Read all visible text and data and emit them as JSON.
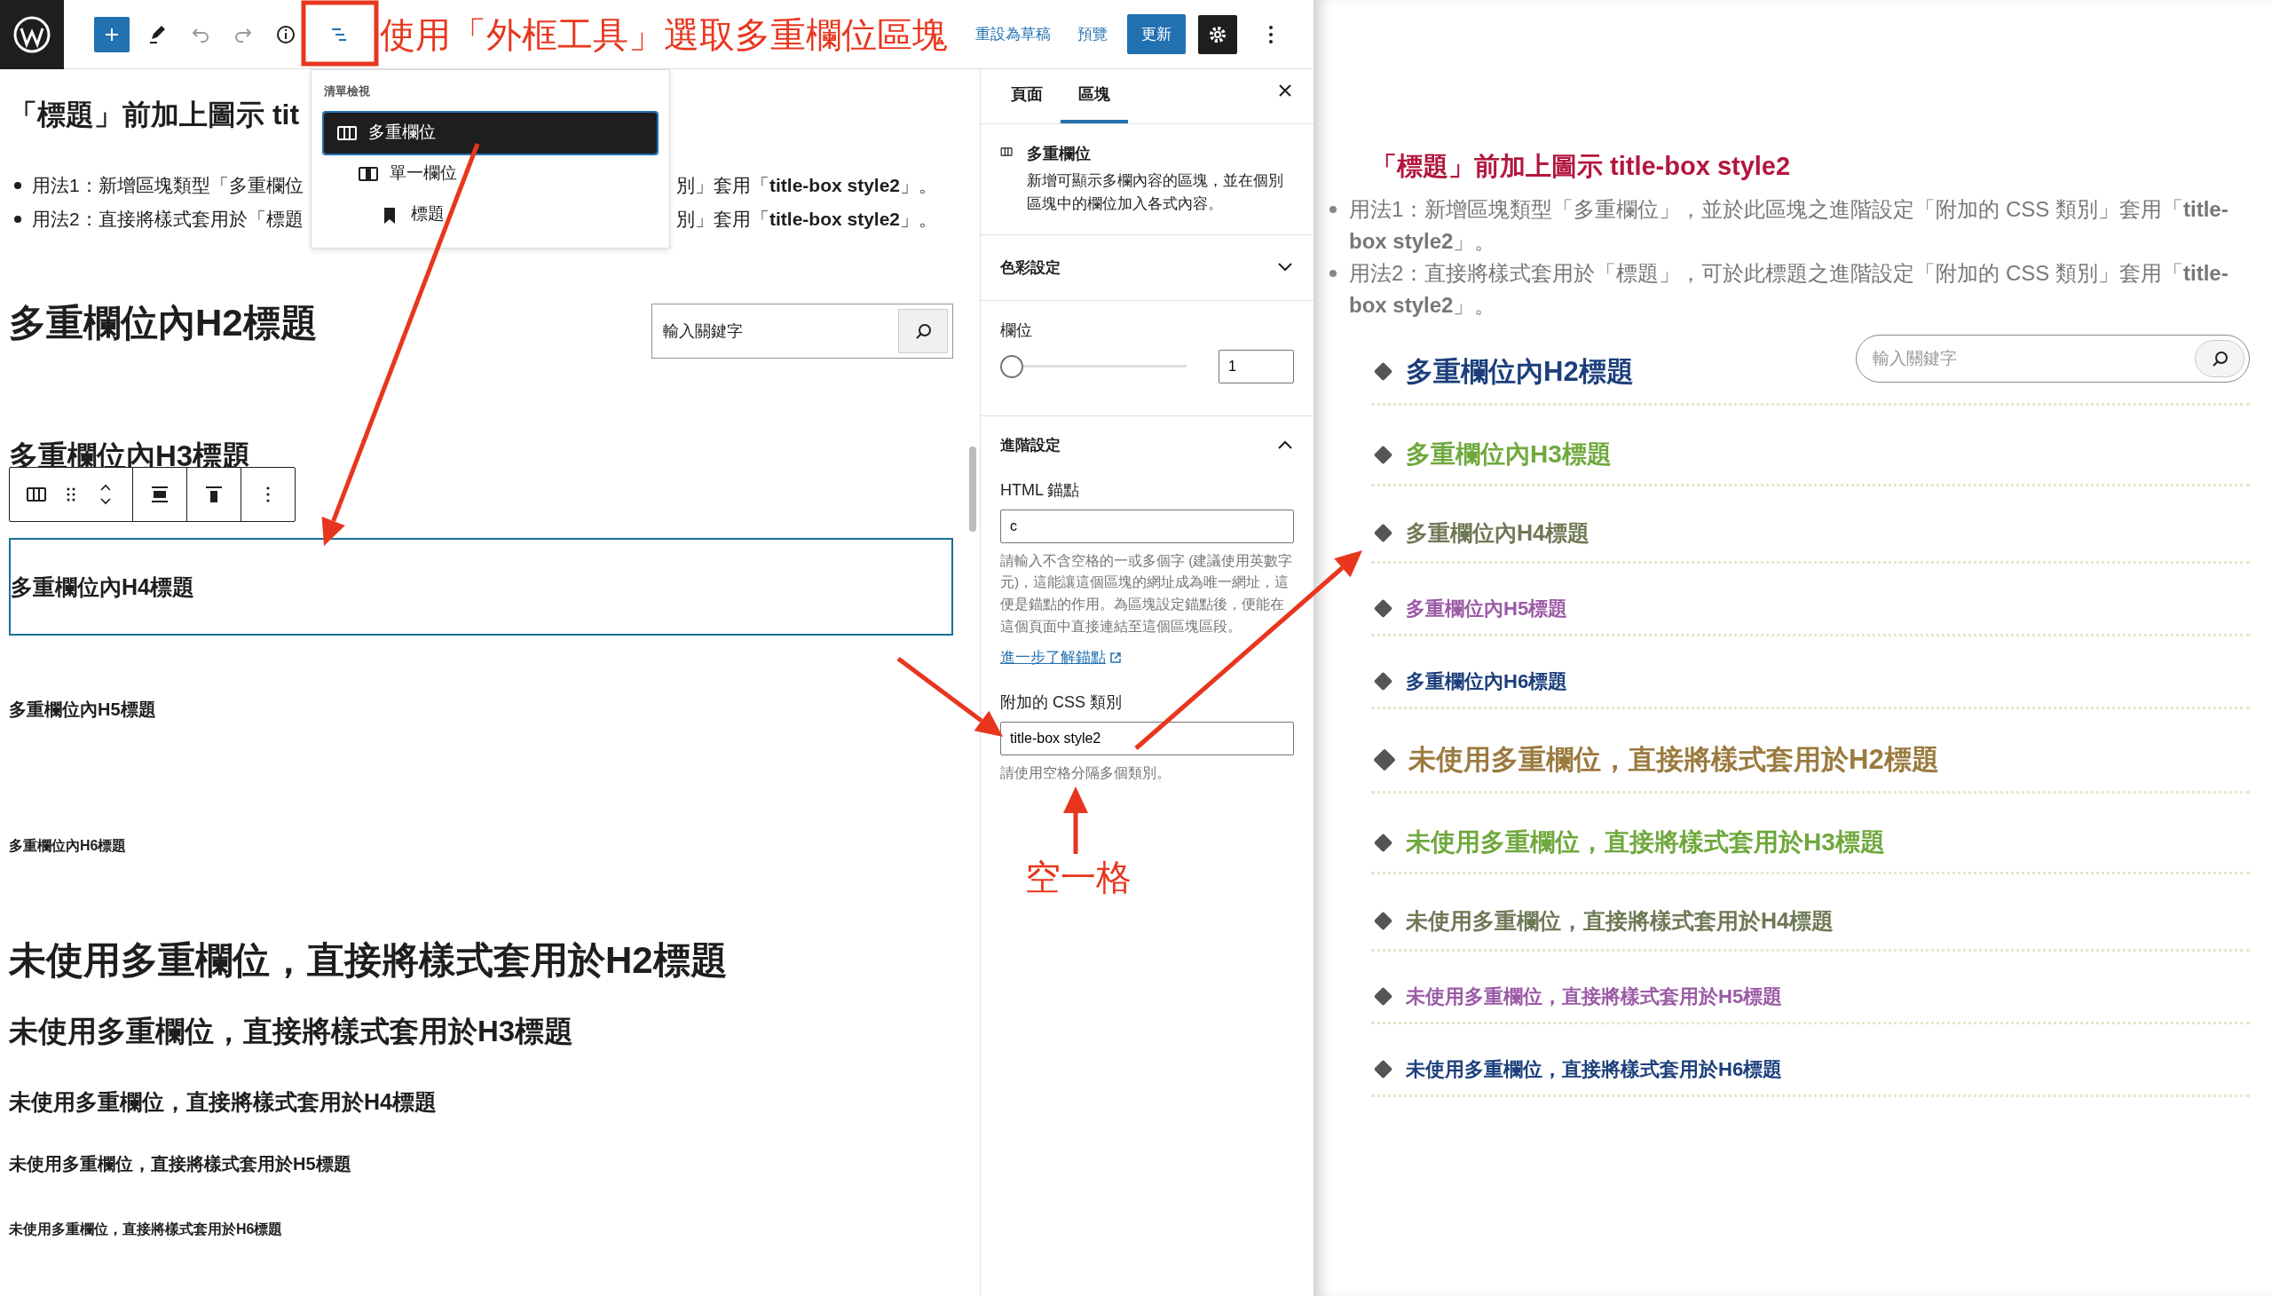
{
  "top_bar": {
    "annotation": "使用「外框工具」選取多重欄位區塊",
    "actions": [
      {
        "label": "重設為草稿",
        "kind": "link"
      },
      {
        "label": "預覽",
        "kind": "link"
      },
      {
        "label": "更新",
        "kind": "primary"
      }
    ]
  },
  "list_view": {
    "title": "清單檢視",
    "items": [
      {
        "label": "多重欄位",
        "selected": true,
        "children": [
          {
            "label": "單一欄位",
            "selected": false,
            "children": [
              {
                "label": "標題",
                "selected": false
              }
            ]
          }
        ]
      }
    ]
  },
  "editor": {
    "title": "「標題」前加上圖示 tit",
    "bullets": [
      {
        "left": "用法1：新增區塊類型「多重欄位",
        "right": "別」套用「**title-box style2**」。"
      },
      {
        "left": "用法2：直接將樣式套用於「標題",
        "right": "別」套用「**title-box style2**」。"
      }
    ],
    "search": {
      "placeholder": "輸入關鍵字"
    },
    "column_headings": [
      {
        "kind": "h2",
        "text": "多重欄位內H2標題",
        "selected": false
      },
      {
        "kind": "h3",
        "text": "多重欄位內H3標題",
        "selected": false
      },
      {
        "kind": "h4",
        "text": "多重欄位內H4標題",
        "selected": true
      },
      {
        "kind": "h5",
        "text": "多重欄位內H5標題",
        "selected": false
      },
      {
        "kind": "h6",
        "text": "多重欄位內H6標題",
        "selected": false
      }
    ],
    "headings": [
      {
        "kind": "h2",
        "text": "未使用多重欄位，直接將樣式套用於H2標題"
      },
      {
        "kind": "h3",
        "text": "未使用多重欄位，直接將樣式套用於H3標題"
      },
      {
        "kind": "h4",
        "text": "未使用多重欄位，直接將樣式套用於H4標題"
      },
      {
        "kind": "h5",
        "text": "未使用多重欄位，直接將樣式套用於H5標題"
      },
      {
        "kind": "h6",
        "text": "未使用多重欄位，直接將樣式套用於H6標題"
      }
    ]
  },
  "sidebar": {
    "tabs": [
      {
        "label": "頁面",
        "selected": false
      },
      {
        "label": "區塊",
        "selected": true
      }
    ],
    "block": {
      "title": "多重欄位",
      "description": "新增可顯示多欄內容的區塊，並在個別區塊中的欄位加入各式內容。"
    },
    "color_panel": {
      "title": "色彩設定",
      "expanded": false
    },
    "columns_control": {
      "label": "欄位",
      "level": 0,
      "value": "1"
    },
    "advanced": {
      "title": "進階設定",
      "expanded": true,
      "anchor": {
        "label": "HTML 錨點",
        "value": "c",
        "help": "請輸入不含空格的一或多個字 (建議使用英數字元)，這能讓這個區塊的網址成為唯一網址，這便是錨點的作用。為區塊設定錨點後，便能在這個頁面中直接連結至這個區塊區段。",
        "link": "進一步了解錨點"
      },
      "css_class": {
        "label": "附加的 CSS 類別",
        "value": "title-box style2",
        "help": "請使用空格分隔多個類別。"
      }
    }
  },
  "annotation_note": "空一格",
  "preview": {
    "title": "「標題」前加上圖示 title-box style2",
    "bullets": [
      "用法1：新增區塊類型「多重欄位」，並於此區塊之進階設定「附加的 CSS 類別」套用「**title-box style2**」。",
      "用法2：直接將樣式套用於「標題」，可於此標題之進階設定「附加的 CSS 類別」套用「**title-box style2**」。"
    ],
    "search": {
      "placeholder": "輸入關鍵字"
    },
    "headings": [
      {
        "kind": "h2",
        "text": "多重欄位內H2標題",
        "color": "#1c3f7c"
      },
      {
        "kind": "h3",
        "text": "多重欄位內H3標題",
        "color": "#6fa83c"
      },
      {
        "kind": "h4",
        "text": "多重欄位內H4標題",
        "color": "#6e7855"
      },
      {
        "kind": "h5",
        "text": "多重欄位內H5標題",
        "color": "#9b5aa6"
      },
      {
        "kind": "h6",
        "text": "多重欄位內H6標題",
        "color": "#1c3f7c"
      },
      {
        "kind": "h2",
        "text": "未使用多重欄位，直接將樣式套用於H2標題",
        "color": "#9a7a3e"
      },
      {
        "kind": "h3",
        "text": "未使用多重欄位，直接將樣式套用於H3標題",
        "color": "#6fa83c"
      },
      {
        "kind": "h4",
        "text": "未使用多重欄位，直接將樣式套用於H4標題",
        "color": "#6e7855"
      },
      {
        "kind": "h5",
        "text": "未使用多重欄位，直接將樣式套用於H5標題",
        "color": "#9b5aa6"
      },
      {
        "kind": "h6",
        "text": "未使用多重欄位，直接將樣式套用於H6標題",
        "color": "#1c3f7c"
      }
    ]
  }
}
